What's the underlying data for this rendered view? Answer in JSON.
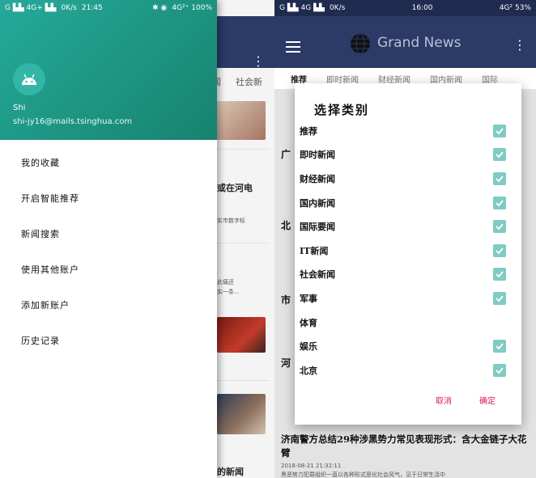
{
  "left": {
    "status": {
      "signal": "G ▙▙ 4G+ ▙▙",
      "net": "0K/s",
      "time": "21:45",
      "icons": "✱ ◉",
      "battery": "4G²⁺ 100%"
    },
    "background": {
      "tabs": [
        "闻",
        "社会新"
      ],
      "headline1": "或在河电",
      "snippet1": "实市数字标",
      "snippet2": "此痛还",
      "snippet3": "实一条...",
      "headline2": "的新闻"
    },
    "drawer": {
      "user_name": "Shi",
      "user_email": "shi-jy16@mails.tsinghua.com",
      "menu": [
        "我的收藏",
        "开启智能推荐",
        "新闻搜索",
        "使用其他账户",
        "添加新账户",
        "历史记录"
      ]
    }
  },
  "right": {
    "status": {
      "signal": "G ▙▙ 4G ▙▙",
      "net": "0K/s",
      "time": "16:00",
      "battery": "4G² 53%"
    },
    "app_title": "Grand News",
    "tabs": [
      "推荐",
      "即时新闻",
      "财经新闻",
      "国内新闻",
      "国际"
    ],
    "background": {
      "headlines": [
        "广",
        "北",
        "市",
        "河"
      ],
      "bottom_headline": "济南警方总结29种涉黑势力常见表现形式：含大金链子大花臂",
      "bottom_date": "2018-08-21 21:32:11",
      "bottom_snippet": "黑恶势力犯罪组织一直以各种形式恶化社会风气，见于日常生活中"
    },
    "dialog": {
      "title": "选择类别",
      "items": [
        {
          "label": "推荐",
          "checked": true
        },
        {
          "label": "即时新闻",
          "checked": true
        },
        {
          "label": "财经新闻",
          "checked": true
        },
        {
          "label": "国内新闻",
          "checked": true
        },
        {
          "label": "国际要闻",
          "checked": true
        },
        {
          "label": "IT新闻",
          "checked": true
        },
        {
          "label": "社会新闻",
          "checked": true
        },
        {
          "label": "军事",
          "checked": true
        },
        {
          "label": "体育",
          "checked": false
        },
        {
          "label": "娱乐",
          "checked": true
        },
        {
          "label": "北京",
          "checked": true
        }
      ],
      "cancel_label": "取消",
      "ok_label": "确定"
    },
    "colors": {
      "checkbox": "#80cbc4",
      "accent": "#d81b60",
      "toolbar": "#2b3a67"
    }
  }
}
